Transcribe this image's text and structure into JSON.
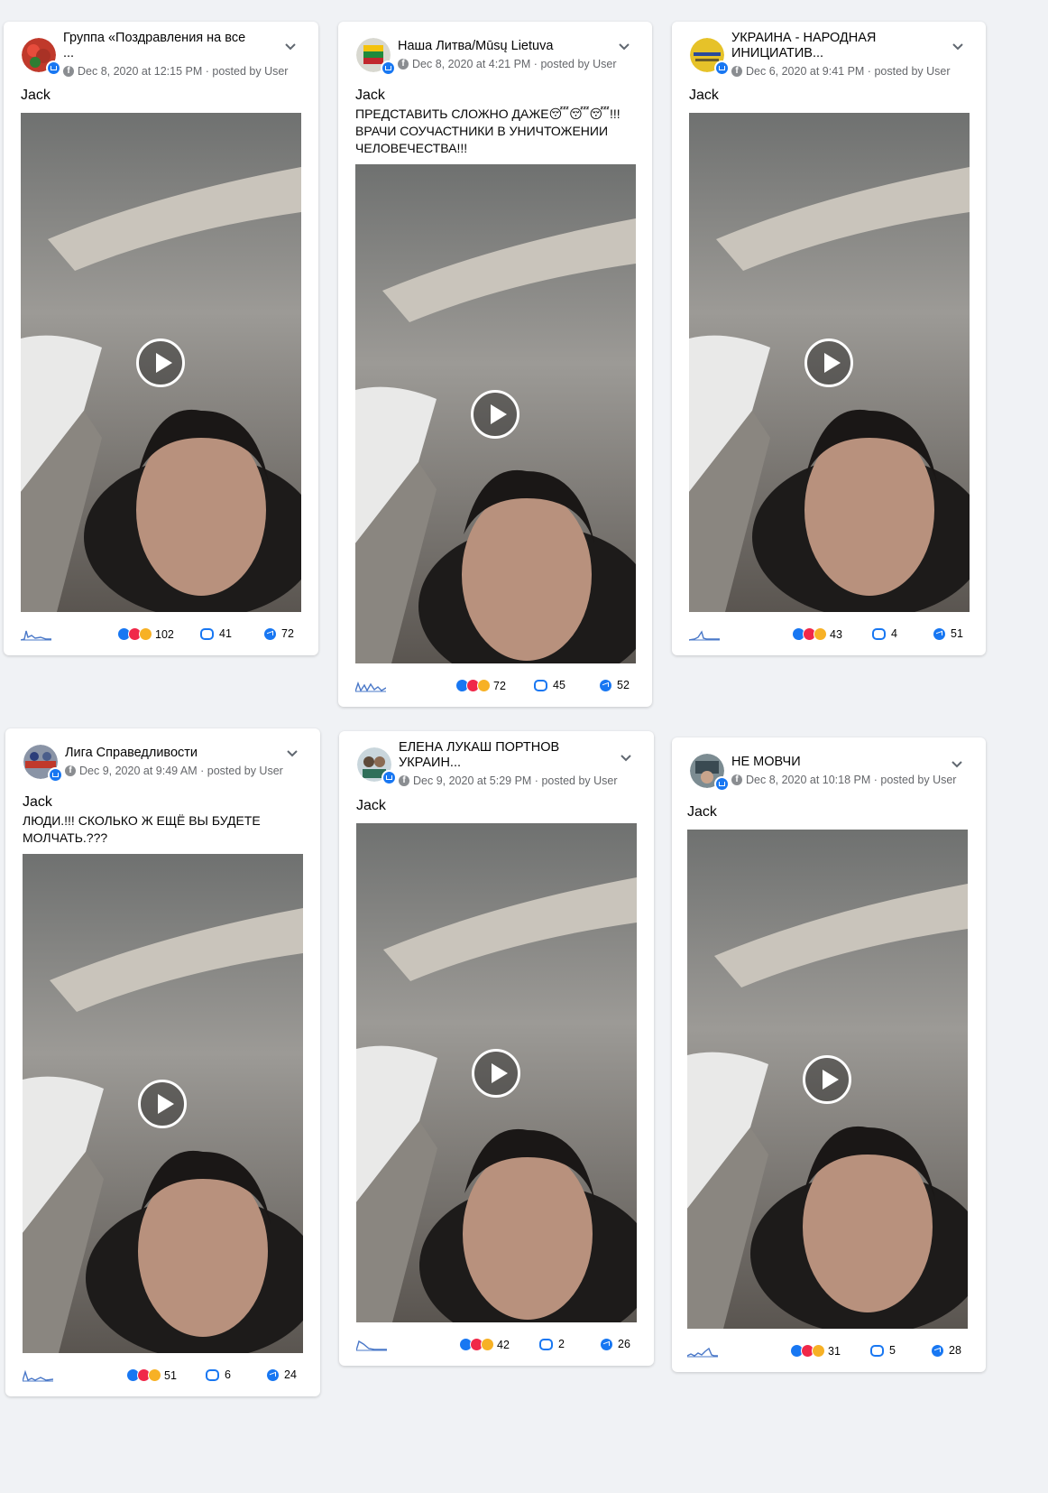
{
  "posts": [
    {
      "group": "Группа «Поздравления на все\n...",
      "meta": "Dec 8, 2020 at 12:15 PM · posted by User",
      "author": "Jack",
      "message": "",
      "reactions": "102",
      "comments": "41",
      "shares": "72",
      "avatar_color": "#c0392b"
    },
    {
      "group": "Наша Литва/Mūsų Lietuva",
      "meta": "Dec 8, 2020 at 4:21 PM · posted by User",
      "author": "Jack",
      "message": "ПРЕДСТАВИТЬ СЛОЖНО ДАЖЕ😴😴😴!!!\nВРАЧИ СОУЧАСТНИКИ В УНИЧТОЖЕНИИ\nЧЕЛОВЕЧЕСТВА!!!",
      "reactions": "72",
      "comments": "45",
      "shares": "52",
      "avatar_color": "#6b8e23"
    },
    {
      "group": "УКРАИНА - НАРОДНАЯ\nИНИЦИАТИВ...",
      "meta": "Dec 6, 2020 at 9:41 PM · posted by User",
      "author": "Jack",
      "message": "",
      "reactions": "43",
      "comments": "4",
      "shares": "51",
      "avatar_color": "#e6c229"
    },
    {
      "group": "Лига Справедливости",
      "meta": "Dec 9, 2020 at 9:49 AM · posted by User",
      "author": "Jack",
      "message": "ЛЮДИ.!!! СКОЛЬКО Ж ЕЩЁ ВЫ БУДЕТЕ\nМОЛЧАТЬ.???",
      "reactions": "51",
      "comments": "6",
      "shares": "24",
      "avatar_color": "#2c3e7a"
    },
    {
      "group": "ЕЛЕНА ЛУКАШ ПОРТНОВ\nУКРАИН...",
      "meta": "Dec 9, 2020 at 5:29 PM · posted by User",
      "author": "Jack",
      "message": "",
      "reactions": "42",
      "comments": "2",
      "shares": "26",
      "avatar_color": "#5d7f8c"
    },
    {
      "group": "НЕ МОВЧИ",
      "meta": "Dec 8, 2020 at 10:18 PM · posted by User",
      "author": "Jack",
      "message": "",
      "reactions": "31",
      "comments": "5",
      "shares": "28",
      "avatar_color": "#4a6a7a"
    }
  ]
}
